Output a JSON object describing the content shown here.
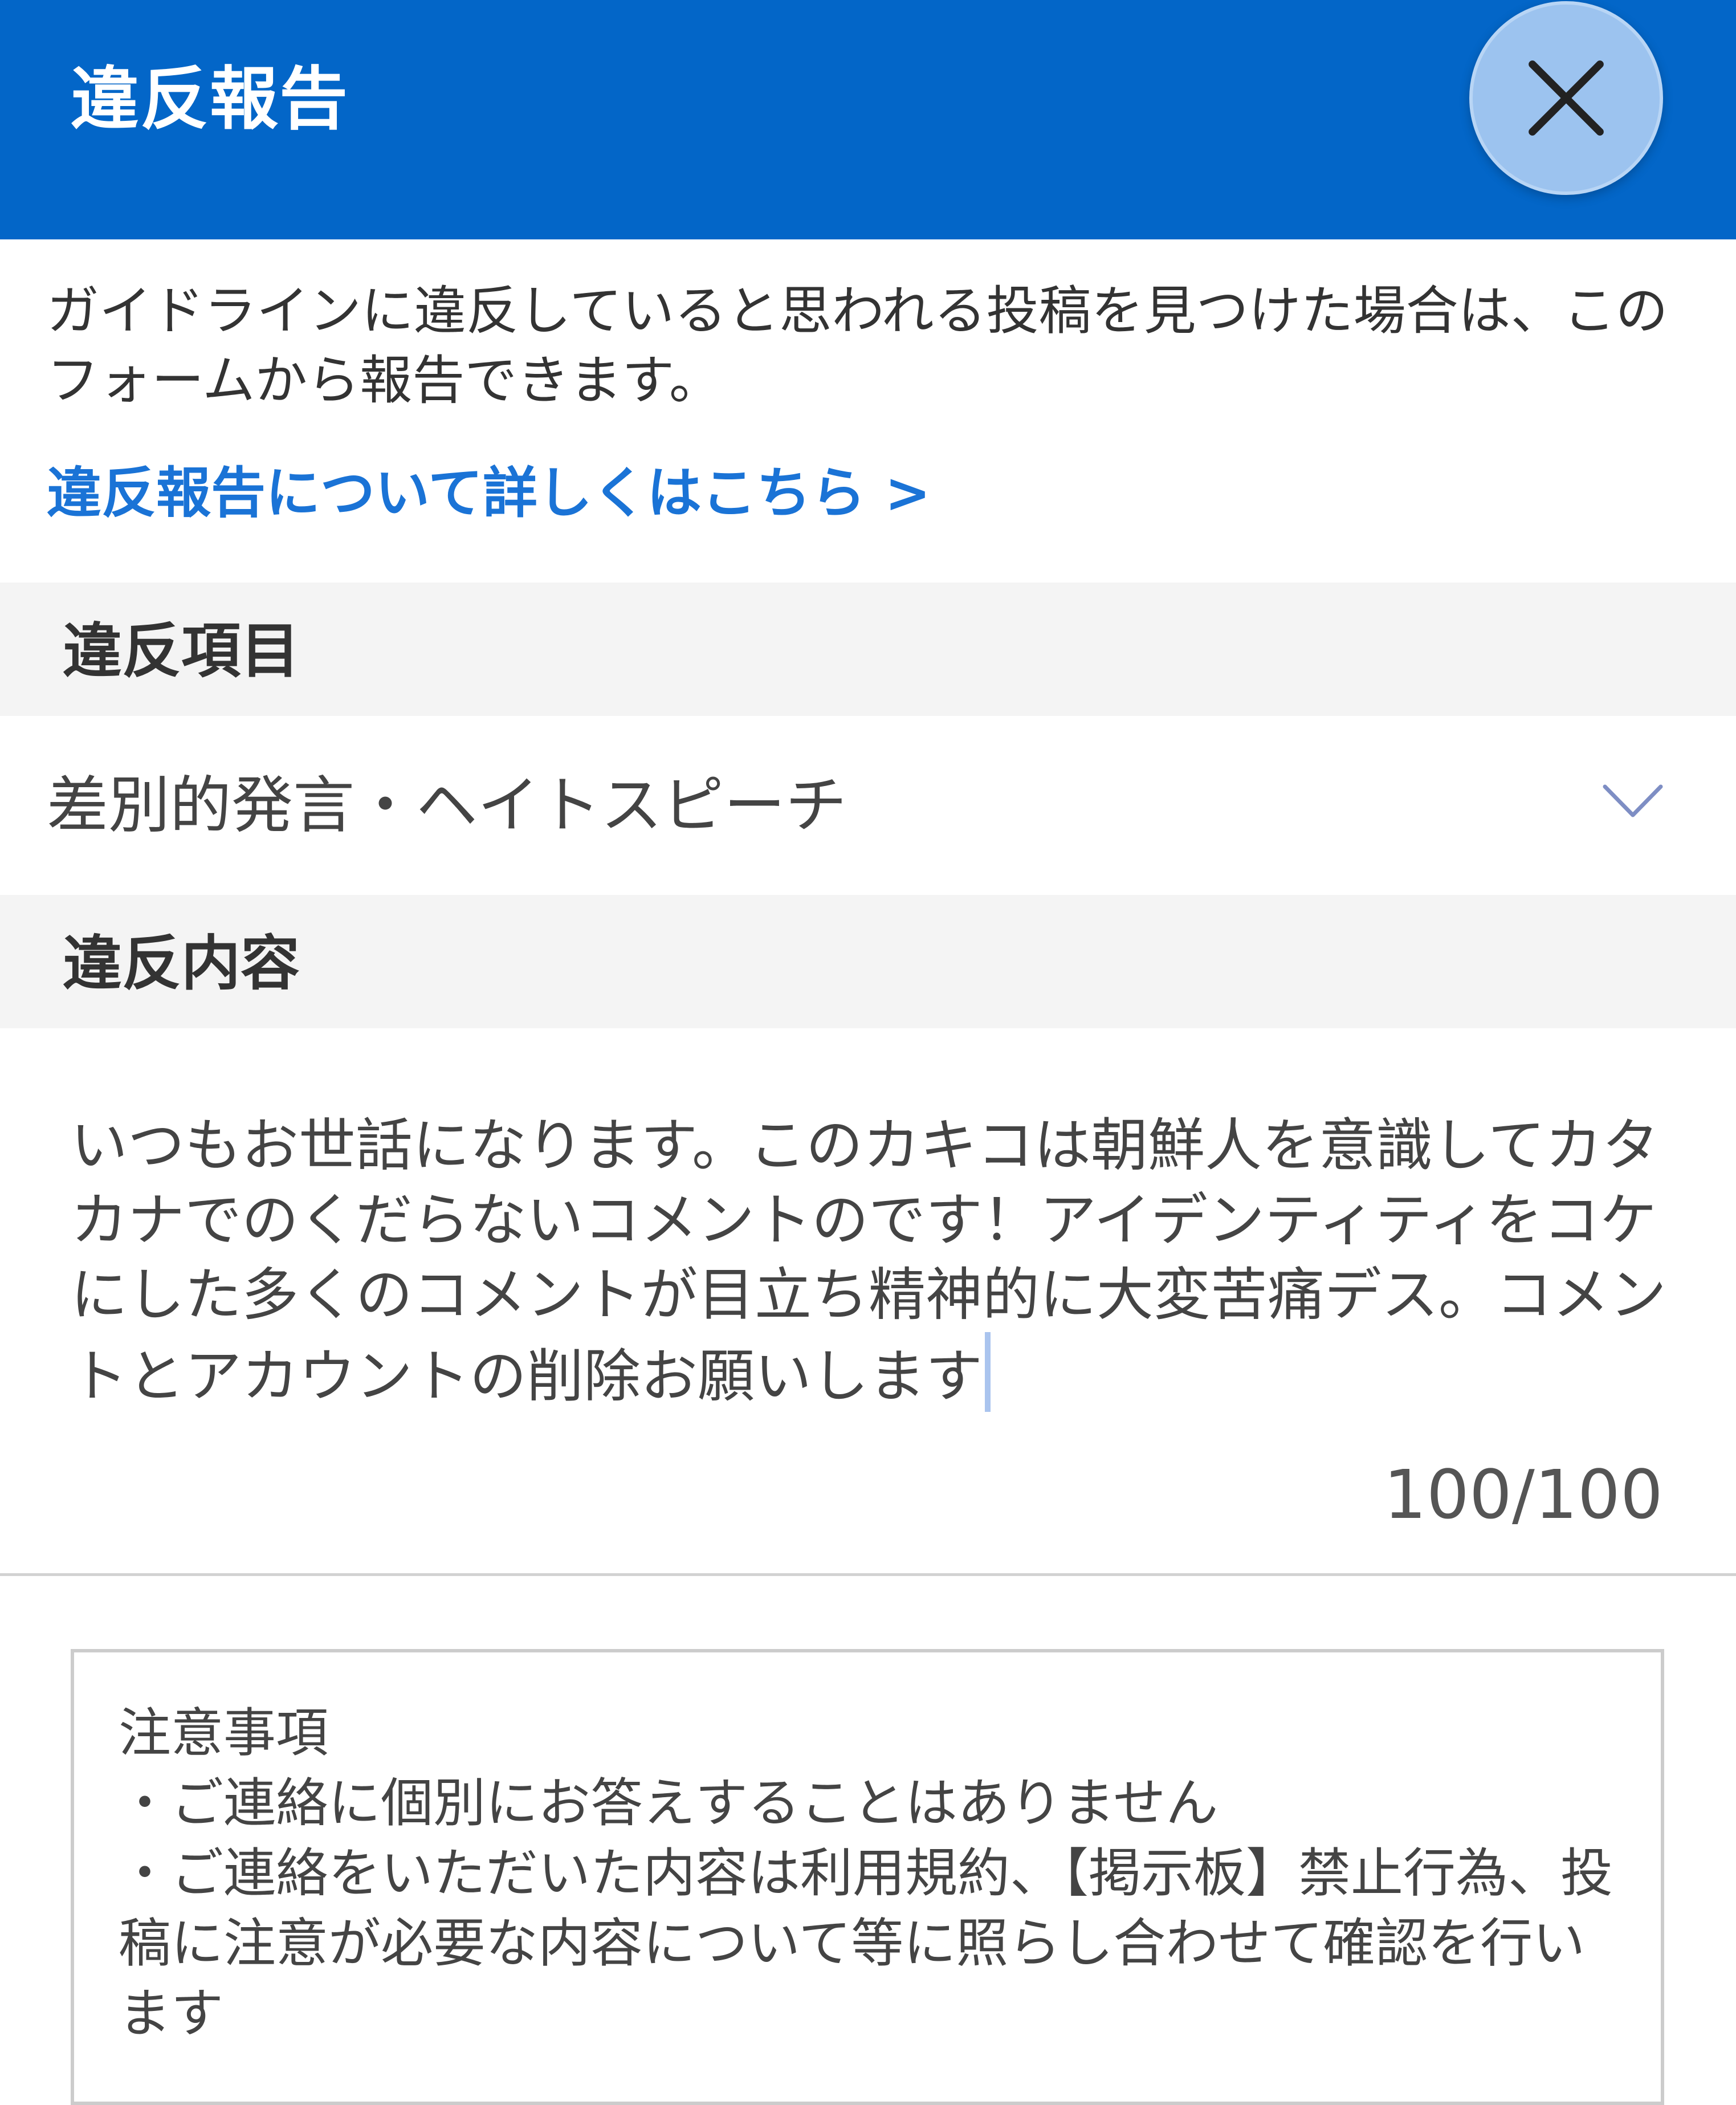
{
  "header": {
    "title": "違反報告",
    "close_icon": "close-icon"
  },
  "intro": {
    "text": "ガイドラインに違反していると思われる投稿を見つけた場合は、このフォームから報告できます。",
    "link_label": "違反報告について詳しくはこちら >"
  },
  "category": {
    "heading": "違反項目",
    "selected": "差別的発言・ヘイトスピーチ",
    "dropdown_icon": "chevron-down-icon"
  },
  "content": {
    "heading": "違反内容",
    "value": "いつもお世話になります。このカキコは朝鮮人を意識してカタカナでのくだらないコメントのです！アイデンティティをコケにした多くのコメントが目立ち精神的に大変苦痛デス。コメントとアカウントの削除お願いします",
    "counter": "100/100"
  },
  "notes": {
    "title": "注意事項",
    "items": [
      "・ご連絡に個別にお答えすることはありません",
      "・ご連絡をいただいた内容は利用規約、【掲示板】禁止行為、投稿に注意が必要な内容について等に照らし合わせて確認を行います"
    ]
  },
  "colors": {
    "header_bg": "#0366c8",
    "link": "#1a73d6",
    "close_button_bg": "#9cc3ef",
    "section_bg": "#f4f4f4"
  }
}
